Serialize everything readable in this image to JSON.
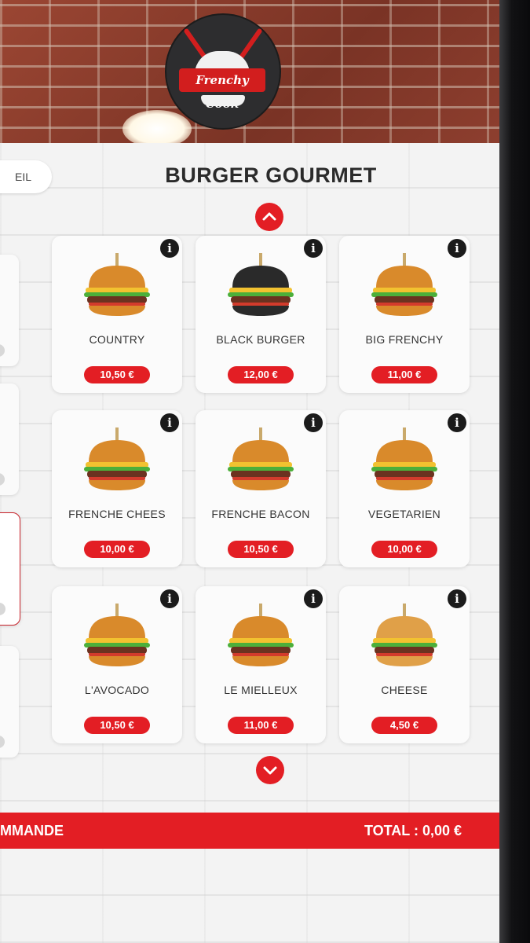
{
  "brand": {
    "logo_text": "Frenchy Cook"
  },
  "header": {
    "home_label": "EIL",
    "title": "BURGER GOURMET"
  },
  "icons": {
    "scroll_up": "chevron-up-icon",
    "scroll_down": "chevron-down-icon",
    "info": "info-icon"
  },
  "colors": {
    "accent": "#e31e24",
    "dark": "#1b1b1b",
    "background": "#f3f3f3"
  },
  "products": [
    {
      "name": "COUNTRY",
      "price": "10,50 €",
      "bun": "#d98a2b"
    },
    {
      "name": "BLACK BURGER",
      "price": "12,00 €",
      "bun": "#2a2a2a"
    },
    {
      "name": "BIG FRENCHY",
      "price": "11,00 €",
      "bun": "#d98a2b"
    },
    {
      "name": "FRENCHE CHEES",
      "price": "10,00 €",
      "bun": "#d98a2b"
    },
    {
      "name": "FRENCHE BACON",
      "price": "10,50 €",
      "bun": "#d98a2b"
    },
    {
      "name": "VEGETARIEN",
      "price": "10,00 €",
      "bun": "#d98a2b"
    },
    {
      "name": "L'AVOCADO",
      "price": "10,50 €",
      "bun": "#d98a2b"
    },
    {
      "name": "LE MIELLEUX",
      "price": "11,00 €",
      "bun": "#d98a2b"
    },
    {
      "name": "CHEESE",
      "price": "4,50 €",
      "bun": "#e0a048"
    }
  ],
  "footer": {
    "order_label": "MMANDE",
    "total_label": "TOTAL : 0,00 €"
  }
}
